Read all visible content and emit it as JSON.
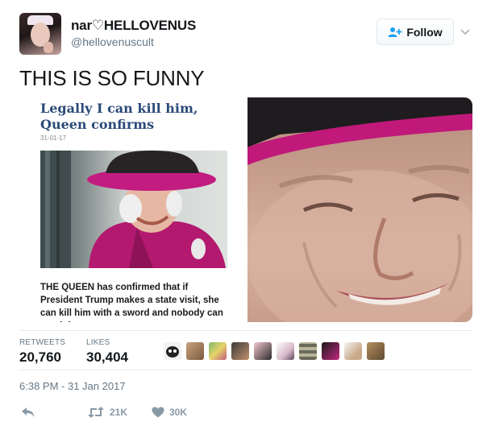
{
  "user": {
    "name_prefix": "nar",
    "heart": "♡",
    "name_suffix": "HELLOVENUS",
    "handle": "@hellovenuscult"
  },
  "follow": {
    "label": "Follow"
  },
  "tweet": {
    "text": "THIS IS SO FUNNY"
  },
  "article": {
    "title": "Legally I can kill him, Queen confirms",
    "date": "31-01-17",
    "body": "THE QUEEN has confirmed that if President Trump makes a state visit, she can kill him with a sword and nobody can touch her"
  },
  "stats": {
    "retweets_label": "RETWEETS",
    "retweets_value": "20,760",
    "likes_label": "LIKES",
    "likes_value": "30,404"
  },
  "timestamp": "6:38 PM - 31 Jan 2017",
  "actions": {
    "retweet_count": "21K",
    "like_count": "30K"
  },
  "colors": {
    "accent_blue": "#1da1f2",
    "muted": "#657786",
    "title_blue": "#2b4a78",
    "magenta": "#c2187a"
  }
}
